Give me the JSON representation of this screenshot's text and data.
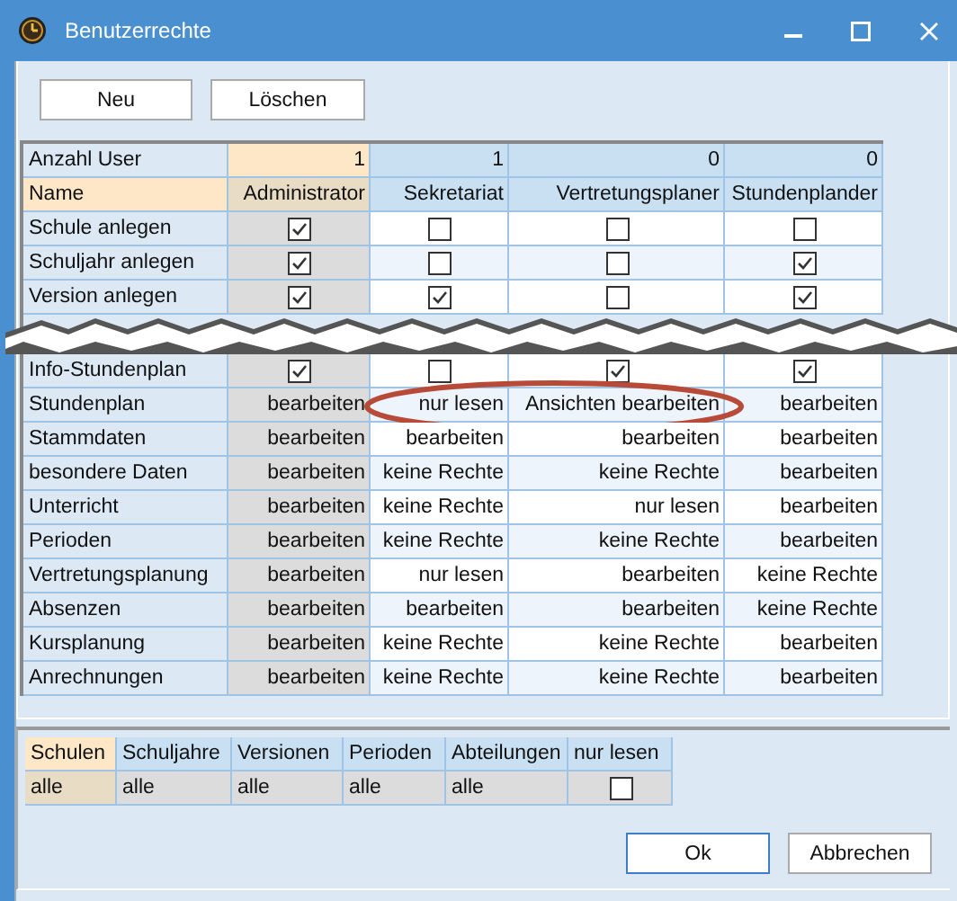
{
  "window": {
    "title": "Benutzerrechte"
  },
  "toolbar": [
    "Neu",
    "Löschen"
  ],
  "table": {
    "count_label": "Anzahl User",
    "name_label": "Name",
    "columns": [
      {
        "name": "Administrator",
        "count": "1",
        "selected": true
      },
      {
        "name": "Sekretariat",
        "count": "1",
        "selected": false
      },
      {
        "name": "Vertretungsplaner",
        "count": "0",
        "selected": false
      },
      {
        "name": "Stundenplander",
        "count": "0",
        "selected": false
      }
    ],
    "rows": [
      {
        "label": "Schule anlegen",
        "kind": "check",
        "cells": [
          {
            "checked": true
          },
          {
            "checked": false
          },
          {
            "checked": false
          },
          {
            "checked": false
          }
        ]
      },
      {
        "label": "Schuljahr anlegen",
        "kind": "check",
        "cells": [
          {
            "checked": true
          },
          {
            "checked": false
          },
          {
            "checked": false
          },
          {
            "checked": true
          }
        ]
      },
      {
        "label": "Version anlegen",
        "kind": "check",
        "cells": [
          {
            "checked": true
          },
          {
            "checked": true
          },
          {
            "checked": false
          },
          {
            "checked": true
          }
        ]
      },
      {
        "kind": "tear"
      },
      {
        "label": "Info-Stundenplan",
        "kind": "check",
        "cells": [
          {
            "checked": true
          },
          {
            "checked": false
          },
          {
            "checked": true
          },
          {
            "checked": true
          }
        ]
      },
      {
        "label": "Stundenplan",
        "kind": "text",
        "circled": true,
        "cells": [
          {
            "text": "bearbeiten"
          },
          {
            "text": "nur lesen"
          },
          {
            "text": "Ansichten bearbeiten"
          },
          {
            "text": "bearbeiten"
          }
        ]
      },
      {
        "label": "Stammdaten",
        "kind": "text",
        "cells": [
          {
            "text": "bearbeiten"
          },
          {
            "text": "bearbeiten"
          },
          {
            "text": "bearbeiten"
          },
          {
            "text": "bearbeiten"
          }
        ]
      },
      {
        "label": "besondere Daten",
        "kind": "text",
        "cells": [
          {
            "text": "bearbeiten"
          },
          {
            "text": "keine Rechte"
          },
          {
            "text": "keine Rechte"
          },
          {
            "text": "bearbeiten"
          }
        ]
      },
      {
        "label": "Unterricht",
        "kind": "text",
        "cells": [
          {
            "text": "bearbeiten"
          },
          {
            "text": "keine Rechte"
          },
          {
            "text": "nur lesen"
          },
          {
            "text": "bearbeiten"
          }
        ]
      },
      {
        "label": "Perioden",
        "kind": "text",
        "cells": [
          {
            "text": "bearbeiten"
          },
          {
            "text": "keine Rechte"
          },
          {
            "text": "keine Rechte"
          },
          {
            "text": "bearbeiten"
          }
        ]
      },
      {
        "label": "Vertretungsplanung",
        "kind": "text",
        "cells": [
          {
            "text": "bearbeiten"
          },
          {
            "text": "nur lesen"
          },
          {
            "text": "bearbeiten"
          },
          {
            "text": "keine Rechte"
          }
        ]
      },
      {
        "label": "Absenzen",
        "kind": "text",
        "cells": [
          {
            "text": "bearbeiten"
          },
          {
            "text": "bearbeiten"
          },
          {
            "text": "bearbeiten"
          },
          {
            "text": "keine Rechte"
          }
        ]
      },
      {
        "label": "Kursplanung",
        "kind": "text",
        "cells": [
          {
            "text": "bearbeiten"
          },
          {
            "text": "keine Rechte"
          },
          {
            "text": "keine Rechte"
          },
          {
            "text": "bearbeiten"
          }
        ]
      },
      {
        "label": "Anrechnungen",
        "kind": "text",
        "cells": [
          {
            "text": "bearbeiten"
          },
          {
            "text": "keine Rechte"
          },
          {
            "text": "keine Rechte"
          },
          {
            "text": "bearbeiten"
          }
        ]
      }
    ]
  },
  "scope": [
    {
      "label": "Schulen",
      "kind": "text",
      "value": "alle",
      "selected": true
    },
    {
      "label": "Schuljahre",
      "kind": "text",
      "value": "alle",
      "selected": false
    },
    {
      "label": "Versionen",
      "kind": "text",
      "value": "alle",
      "selected": false
    },
    {
      "label": "Perioden",
      "kind": "text",
      "value": "alle",
      "selected": false
    },
    {
      "label": "Abteilungen",
      "kind": "text",
      "value": "alle",
      "selected": false
    },
    {
      "label": "nur lesen",
      "kind": "check",
      "checked": false,
      "selected": false
    }
  ],
  "buttons": [
    "Ok",
    "Abbrechen"
  ]
}
